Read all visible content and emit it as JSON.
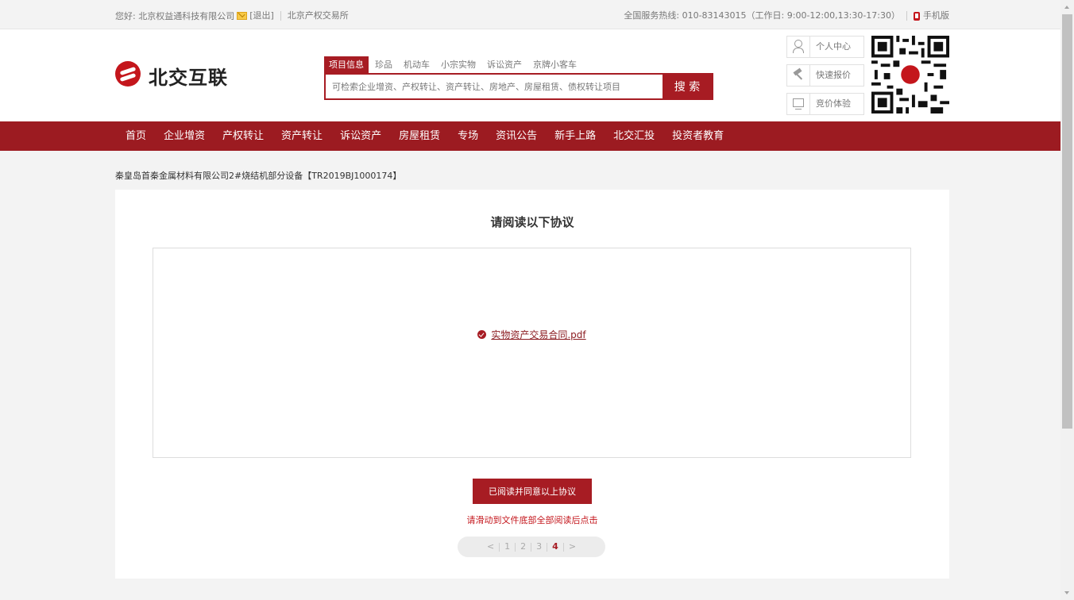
{
  "topbar": {
    "greeting": "您好: 北京权益通科技有限公司",
    "logout": "[退出]",
    "exchange": "北京产权交易所",
    "hotline": "全国服务热线: 010-83143015（工作日: 9:00-12:00,13:30-17:30）",
    "mobile": "手机版"
  },
  "header": {
    "logo_text": "北交互联",
    "tabs": [
      "项目信息",
      "珍品",
      "机动车",
      "小宗实物",
      "诉讼资产",
      "京牌小客车"
    ],
    "search_placeholder": "可检索企业增资、产权转让、资产转让、房地产、房屋租赁、债权转让项目",
    "search_button": "搜 索",
    "quick_links": [
      "个人中心",
      "快速报价",
      "竞价体验"
    ]
  },
  "nav": [
    "首页",
    "企业增资",
    "产权转让",
    "资产转让",
    "诉讼资产",
    "房屋租赁",
    "专场",
    "资讯公告",
    "新手上路",
    "北交汇投",
    "投资者教育"
  ],
  "breadcrumb": "秦皇岛首秦金属材料有限公司2#烧结机部分设备【TR2019BJ1000174】",
  "agreement": {
    "title": "请阅读以下协议",
    "file_name": "实物资产交易合同.pdf",
    "agree_button": "已阅读并同意以上协议",
    "hint": "请滑动到文件底部全部阅读后点击"
  },
  "pager": {
    "prev": "<",
    "pages": [
      "1",
      "2",
      "3",
      "4"
    ],
    "current": "4",
    "next": ">"
  },
  "colors": {
    "brand": "#a71c23",
    "nav": "#9c1b21",
    "hint": "#c4161c"
  }
}
